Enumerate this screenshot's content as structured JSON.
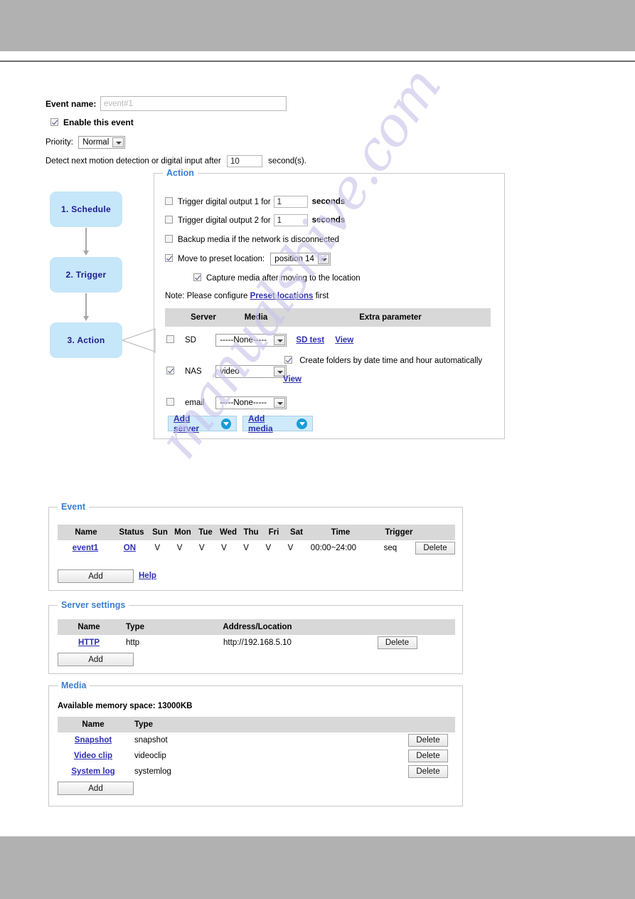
{
  "page": {
    "watermark": "manualshive.com"
  },
  "form": {
    "event_name_label": "Event name:",
    "event_name_placeholder": "event#1",
    "enable_label": "Enable this event",
    "enable_checked": true,
    "priority_label": "Priority:",
    "priority_value": "Normal",
    "detect_prefix": "Detect next motion detection or digital input after",
    "detect_value": "10",
    "detect_suffix": "second(s)."
  },
  "steps": [
    {
      "label": "1.  Schedule"
    },
    {
      "label": "2.  Trigger"
    },
    {
      "label": "3.  Action"
    }
  ],
  "action": {
    "legend": "Action",
    "rows": [
      {
        "label": "Trigger digital output 1 for",
        "value": "1",
        "unit": "seconds",
        "checked": false
      },
      {
        "label": "Trigger digital output 2 for",
        "value": "1",
        "unit": "seconds",
        "checked": false
      }
    ],
    "backup_label": "Backup media if the network is disconnected",
    "backup_checked": false,
    "preset_label": "Move to preset location:",
    "preset_checked": true,
    "preset_value": "position 14",
    "capture_label": "Capture media after moving to the location",
    "capture_checked": true,
    "note_prefix": "Note: Please configure",
    "note_link": "Preset locations",
    "note_suffix": "first",
    "table": {
      "headers": {
        "server": "Server",
        "media": "Media",
        "extra": "Extra parameter"
      },
      "rows": [
        {
          "name": "SD",
          "checked": false,
          "media": "-----None-----",
          "links": [
            "SD test",
            "View"
          ]
        },
        {
          "name": "NAS",
          "checked": true,
          "media": "video",
          "extra_checkbox_label": "Create folders by date time and hour automatically",
          "extra_checkbox_checked": true,
          "links": [
            "View"
          ]
        },
        {
          "name": "email",
          "checked": false,
          "media": "-----None-----",
          "links": []
        }
      ]
    },
    "add_server_label": "Add server",
    "add_media_label": "Add media"
  },
  "event_panel": {
    "legend": "Event",
    "headers": [
      "Name",
      "Status",
      "Sun",
      "Mon",
      "Tue",
      "Wed",
      "Thu",
      "Fri",
      "Sat",
      "Time",
      "Trigger",
      ""
    ],
    "row": {
      "name": "event1",
      "status": "ON",
      "days": [
        "V",
        "V",
        "V",
        "V",
        "V",
        "V",
        "V"
      ],
      "time": "00:00~24:00",
      "trigger": "seq",
      "delete_label": "Delete"
    },
    "add_label": "Add",
    "help_label": "Help"
  },
  "server_panel": {
    "legend": "Server settings",
    "headers": [
      "Name",
      "Type",
      "Address/Location",
      ""
    ],
    "rows": [
      {
        "name": "HTTP",
        "type": "http",
        "address": "http://192.168.5.10",
        "delete_label": "Delete"
      }
    ],
    "add_label": "Add"
  },
  "media_panel": {
    "legend": "Media",
    "memory_line": "Available memory space: 13000KB",
    "headers": [
      "Name",
      "Type",
      ""
    ],
    "rows": [
      {
        "name": "Snapshot",
        "type": "snapshot",
        "delete_label": "Delete"
      },
      {
        "name": "Video clip",
        "type": "videoclip",
        "delete_label": "Delete"
      },
      {
        "name": "System log",
        "type": "systemlog",
        "delete_label": "Delete"
      }
    ],
    "add_label": "Add"
  }
}
